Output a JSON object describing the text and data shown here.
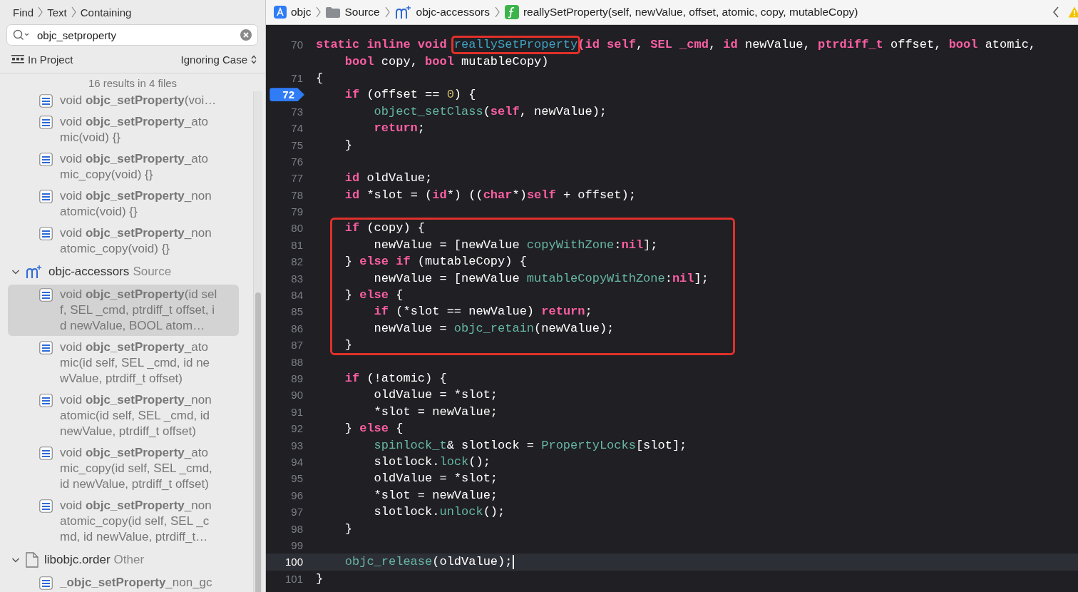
{
  "find_navigator": {
    "breadcrumb": [
      "Find",
      "Text",
      "Containing"
    ],
    "search": {
      "value": "objc_setproperty"
    },
    "scope": "In Project",
    "matching": "Ignoring Case",
    "summary": "16 results in 4 files",
    "results": [
      {
        "kind": "match",
        "text": "void **objc_setProperty**(voi…",
        "selected": false
      },
      {
        "kind": "match",
        "text": "void **objc_setProperty**_atomic(void) {}",
        "selected": false
      },
      {
        "kind": "match",
        "text": "void **objc_setProperty**_atomic_copy(void) {}",
        "selected": false
      },
      {
        "kind": "match",
        "text": "void **objc_setProperty**_nonatomic(void) {}",
        "selected": false
      },
      {
        "kind": "match",
        "text": "void **objc_setProperty**_nonatomic_copy(void) {}",
        "selected": false
      },
      {
        "kind": "objc_file",
        "name": "objc-accessors",
        "group": "Source",
        "expanded": true,
        "children": [
          {
            "kind": "match",
            "text": "void **objc_setProperty**(id self, SEL _cmd, ptrdiff_t offset, id newValue, BOOL atom…",
            "selected": true
          },
          {
            "kind": "match",
            "text": "void **objc_setProperty**_atomic(id self, SEL _cmd, id newValue, ptrdiff_t offset)",
            "selected": false
          },
          {
            "kind": "match",
            "text": "void **objc_setProperty**_nonatomic(id self, SEL _cmd, id newValue, ptrdiff_t offset)",
            "selected": false
          },
          {
            "kind": "match",
            "text": "void **objc_setProperty**_atomic_copy(id self, SEL _cmd, id newValue, ptrdiff_t offset)",
            "selected": false
          },
          {
            "kind": "match",
            "text": "void **objc_setProperty**_nonatomic_copy(id self, SEL _cmd, id newValue, ptrdiff_t…",
            "selected": false
          }
        ]
      },
      {
        "kind": "text_file",
        "name": "libobjc.order",
        "group": "Other",
        "expanded": true,
        "children": [
          {
            "kind": "match",
            "text": "**_objc_setProperty**_non_gc",
            "selected": false
          }
        ]
      }
    ]
  },
  "jump_bar": [
    {
      "kind": "project",
      "text": "objc"
    },
    {
      "kind": "folder",
      "text": "Source"
    },
    {
      "kind": "objc_file",
      "text": "objc-accessors"
    },
    {
      "kind": "function",
      "text": "reallySetProperty(self, newValue, offset, atomic, copy, mutableCopy)"
    }
  ],
  "code": {
    "blocks": [
      {
        "boxed": false,
        "rows": [
          {
            "number": "70",
            "breakpoint": false,
            "current": false,
            "tokens": [
              {
                "kind": "keyword",
                "text": "static inline void "
              },
              {
                "kind": "declaration",
                "text": "reallySetProperty",
                "boxed": true
              },
              {
                "kind": "keyword",
                "text": "(id self"
              },
              {
                "kind": "plain",
                "text": ", "
              },
              {
                "kind": "keyword",
                "text": "SEL _cmd"
              },
              {
                "kind": "plain",
                "text": ", "
              },
              {
                "kind": "keyword",
                "text": "id"
              },
              {
                "kind": "plain",
                "text": " newValue, "
              },
              {
                "kind": "keyword",
                "text": "ptrdiff_t"
              },
              {
                "kind": "plain",
                "text": " offset, "
              },
              {
                "kind": "keyword",
                "text": "bool"
              },
              {
                "kind": "plain",
                "text": " atomic,"
              }
            ]
          },
          {
            "current": false,
            "tokens": [
              {
                "kind": "keyword",
                "text": "    bool"
              },
              {
                "kind": "plain",
                "text": " copy, "
              },
              {
                "kind": "keyword",
                "text": "bool"
              },
              {
                "kind": "plain",
                "text": " mutableCopy)"
              }
            ]
          },
          {
            "number": "71",
            "breakpoint": false,
            "current": false,
            "tokens": [
              {
                "kind": "plain",
                "text": "{"
              }
            ]
          },
          {
            "number": "72",
            "breakpoint": true,
            "current": false,
            "tokens": [
              {
                "kind": "keyword",
                "text": "    if"
              },
              {
                "kind": "plain",
                "text": " (offset == "
              },
              {
                "kind": "number",
                "text": "0"
              },
              {
                "kind": "plain",
                "text": ") {"
              }
            ]
          },
          {
            "number": "73",
            "breakpoint": false,
            "current": false,
            "tokens": [
              {
                "kind": "call",
                "text": "        object_setClass"
              },
              {
                "kind": "plain",
                "text": "("
              },
              {
                "kind": "keyword",
                "text": "self"
              },
              {
                "kind": "plain",
                "text": ", newValue);"
              }
            ]
          },
          {
            "number": "74",
            "breakpoint": false,
            "current": false,
            "tokens": [
              {
                "kind": "keyword",
                "text": "        return"
              },
              {
                "kind": "plain",
                "text": ";"
              }
            ]
          },
          {
            "number": "75",
            "breakpoint": false,
            "current": false,
            "tokens": [
              {
                "kind": "plain",
                "text": "    }"
              }
            ]
          },
          {
            "number": "76",
            "breakpoint": false,
            "current": false
          },
          {
            "number": "77",
            "breakpoint": false,
            "current": false,
            "tokens": [
              {
                "kind": "keyword",
                "text": "    id"
              },
              {
                "kind": "plain",
                "text": " oldValue;"
              }
            ]
          },
          {
            "number": "78",
            "breakpoint": false,
            "current": false,
            "tokens": [
              {
                "kind": "keyword",
                "text": "    id"
              },
              {
                "kind": "plain",
                "text": " *slot = ("
              },
              {
                "kind": "keyword",
                "text": "id"
              },
              {
                "kind": "plain",
                "text": "*) (("
              },
              {
                "kind": "keyword",
                "text": "char"
              },
              {
                "kind": "plain",
                "text": "*)"
              },
              {
                "kind": "keyword",
                "text": "self"
              },
              {
                "kind": "plain",
                "text": " + offset);"
              }
            ]
          },
          {
            "number": "79",
            "breakpoint": false,
            "current": false
          }
        ]
      },
      {
        "boxed": true,
        "rows": [
          {
            "number": "80",
            "breakpoint": false,
            "current": false,
            "tokens": [
              {
                "kind": "keyword",
                "text": "    if"
              },
              {
                "kind": "plain",
                "text": " (copy) {"
              }
            ]
          },
          {
            "number": "81",
            "breakpoint": false,
            "current": false,
            "tokens": [
              {
                "kind": "plain",
                "text": "        newValue = [newValue "
              },
              {
                "kind": "call",
                "text": "copyWithZone"
              },
              {
                "kind": "plain",
                "text": ":"
              },
              {
                "kind": "keyword",
                "text": "nil"
              },
              {
                "kind": "plain",
                "text": "];"
              }
            ]
          },
          {
            "number": "82",
            "breakpoint": false,
            "current": false,
            "tokens": [
              {
                "kind": "plain",
                "text": "    } "
              },
              {
                "kind": "keyword",
                "text": "else if"
              },
              {
                "kind": "plain",
                "text": " (mutableCopy) {"
              }
            ]
          },
          {
            "number": "83",
            "breakpoint": false,
            "current": false,
            "tokens": [
              {
                "kind": "plain",
                "text": "        newValue = [newValue "
              },
              {
                "kind": "call",
                "text": "mutableCopyWithZone"
              },
              {
                "kind": "plain",
                "text": ":"
              },
              {
                "kind": "keyword",
                "text": "nil"
              },
              {
                "kind": "plain",
                "text": "];"
              }
            ]
          },
          {
            "number": "84",
            "breakpoint": false,
            "current": false,
            "tokens": [
              {
                "kind": "plain",
                "text": "    } "
              },
              {
                "kind": "keyword",
                "text": "else"
              },
              {
                "kind": "plain",
                "text": " {"
              }
            ]
          },
          {
            "number": "85",
            "breakpoint": false,
            "current": false,
            "tokens": [
              {
                "kind": "keyword",
                "text": "        if"
              },
              {
                "kind": "plain",
                "text": " (*slot == newValue) "
              },
              {
                "kind": "keyword",
                "text": "return"
              },
              {
                "kind": "plain",
                "text": ";"
              }
            ]
          },
          {
            "number": "86",
            "breakpoint": false,
            "current": false,
            "tokens": [
              {
                "kind": "plain",
                "text": "        newValue = "
              },
              {
                "kind": "call",
                "text": "objc_retain"
              },
              {
                "kind": "plain",
                "text": "(newValue);"
              }
            ]
          },
          {
            "number": "87",
            "breakpoint": false,
            "current": false,
            "tokens": [
              {
                "kind": "plain",
                "text": "    }"
              }
            ]
          }
        ]
      },
      {
        "boxed": false,
        "rows": [
          {
            "number": "88",
            "breakpoint": false,
            "current": false
          },
          {
            "number": "89",
            "breakpoint": false,
            "current": false,
            "tokens": [
              {
                "kind": "keyword",
                "text": "    if"
              },
              {
                "kind": "plain",
                "text": " (!atomic) {"
              }
            ]
          },
          {
            "number": "90",
            "breakpoint": false,
            "current": false,
            "tokens": [
              {
                "kind": "plain",
                "text": "        oldValue = *slot;"
              }
            ]
          },
          {
            "number": "91",
            "breakpoint": false,
            "current": false,
            "tokens": [
              {
                "kind": "plain",
                "text": "        *slot = newValue;"
              }
            ]
          },
          {
            "number": "92",
            "breakpoint": false,
            "current": false,
            "tokens": [
              {
                "kind": "plain",
                "text": "    } "
              },
              {
                "kind": "keyword",
                "text": "else"
              },
              {
                "kind": "plain",
                "text": " {"
              }
            ]
          },
          {
            "number": "93",
            "breakpoint": false,
            "current": false,
            "tokens": [
              {
                "kind": "call",
                "text": "        spinlock_t"
              },
              {
                "kind": "plain",
                "text": "& slotlock = "
              },
              {
                "kind": "call",
                "text": "PropertyLocks"
              },
              {
                "kind": "plain",
                "text": "[slot];"
              }
            ]
          },
          {
            "number": "94",
            "breakpoint": false,
            "current": false,
            "tokens": [
              {
                "kind": "plain",
                "text": "        slotlock."
              },
              {
                "kind": "call",
                "text": "lock"
              },
              {
                "kind": "plain",
                "text": "();"
              }
            ]
          },
          {
            "number": "95",
            "breakpoint": false,
            "current": false,
            "tokens": [
              {
                "kind": "plain",
                "text": "        oldValue = *slot;"
              }
            ]
          },
          {
            "number": "96",
            "breakpoint": false,
            "current": false,
            "tokens": [
              {
                "kind": "plain",
                "text": "        *slot = newValue;"
              }
            ]
          },
          {
            "number": "97",
            "breakpoint": false,
            "current": false,
            "tokens": [
              {
                "kind": "plain",
                "text": "        slotlock."
              },
              {
                "kind": "call",
                "text": "unlock"
              },
              {
                "kind": "plain",
                "text": "();"
              }
            ]
          },
          {
            "number": "98",
            "breakpoint": false,
            "current": false,
            "tokens": [
              {
                "kind": "plain",
                "text": "    }"
              }
            ]
          },
          {
            "number": "99",
            "breakpoint": false,
            "current": false
          },
          {
            "number": "100",
            "breakpoint": false,
            "current": true,
            "tokens": [
              {
                "kind": "call",
                "text": "    objc_release"
              },
              {
                "kind": "plain",
                "text": "(oldValue);"
              }
            ]
          },
          {
            "number": "101",
            "breakpoint": false,
            "current": false,
            "tokens": [
              {
                "kind": "plain",
                "text": "}"
              }
            ]
          }
        ]
      }
    ]
  }
}
